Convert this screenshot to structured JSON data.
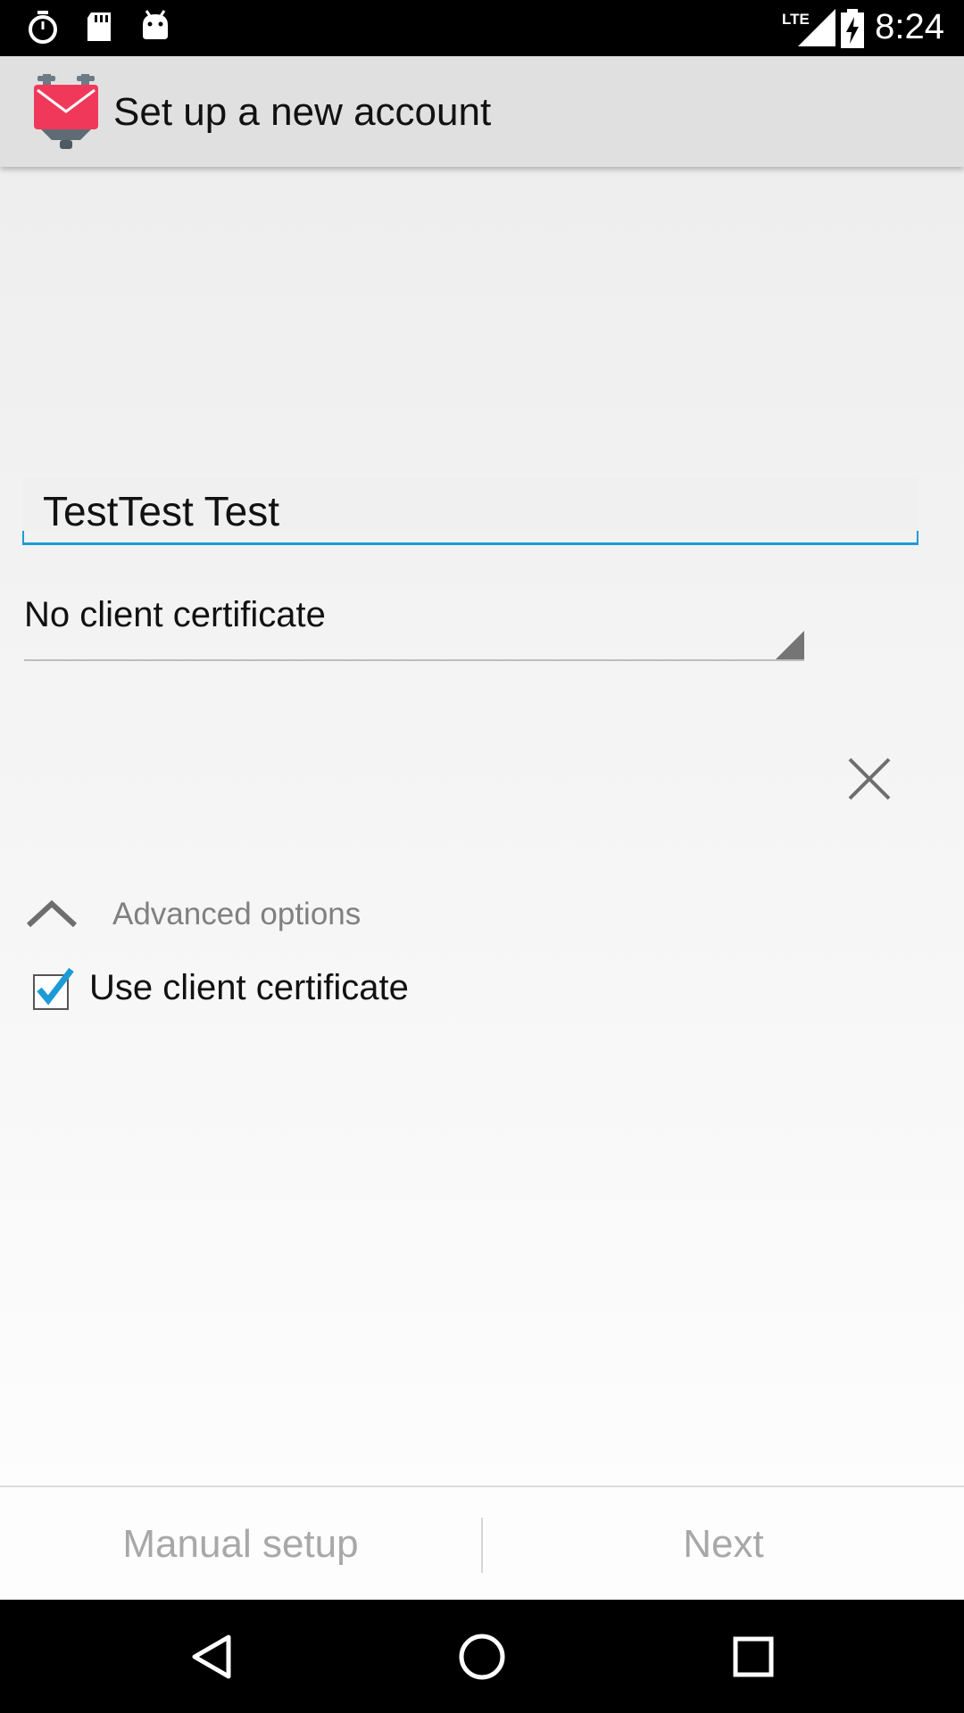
{
  "status_bar": {
    "time": "8:24",
    "network_label": "LTE",
    "left_icons": [
      "timer-icon",
      "sd-card-icon",
      "android-debug-icon"
    ],
    "right_icons": [
      "lte-signal-icon",
      "battery-charging-icon"
    ]
  },
  "app_bar": {
    "title": "Set up a new account",
    "logo": "k9-mail-logo",
    "colors": {
      "background": "#e0e0e0",
      "logo": "#f0395a"
    }
  },
  "form": {
    "name_value": "TestTest Test",
    "certificate_selected": "No client certificate",
    "advanced_options_label": "Advanced options",
    "use_client_certificate_label": "Use client certificate",
    "use_client_certificate_checked": true,
    "accent_color": "#1e9bd7"
  },
  "actions": {
    "manual_setup_label": "Manual setup",
    "next_label": "Next"
  },
  "nav_bar": {
    "icons": [
      "back-icon",
      "home-icon",
      "recents-icon"
    ]
  }
}
